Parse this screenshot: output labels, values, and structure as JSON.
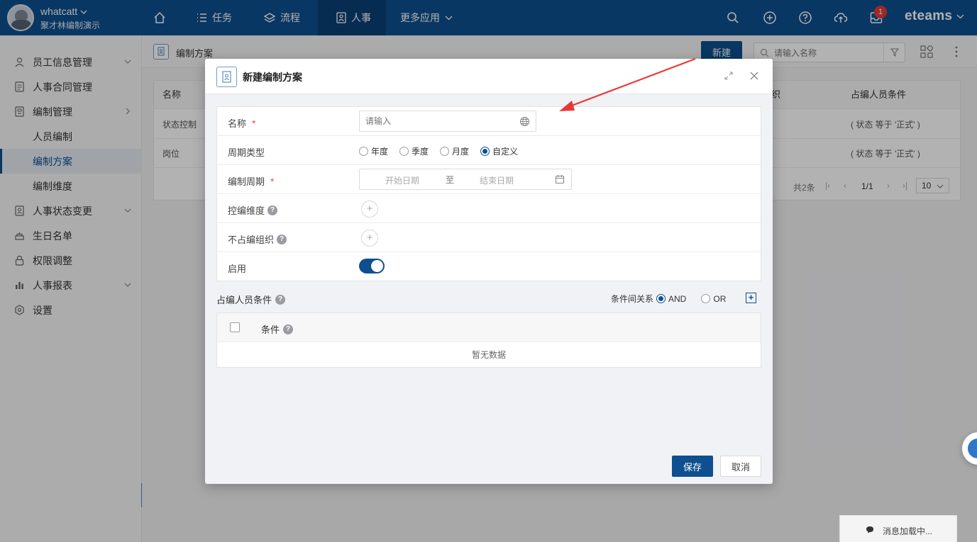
{
  "user": {
    "name": "whatcatt",
    "org": "聚才林编制演示"
  },
  "nav": [
    {
      "label": "",
      "icon": "home-icon"
    },
    {
      "label": "任务",
      "icon": "list-icon"
    },
    {
      "label": "流程",
      "icon": "layers-icon"
    },
    {
      "label": "人事",
      "icon": "person-doc-icon",
      "active": true
    },
    {
      "label": "更多应用",
      "icon": "chevron-down-icon"
    }
  ],
  "topbar": {
    "notification_count": "1",
    "brand": "eteams"
  },
  "sidebar": {
    "items": [
      {
        "label": "员工信息管理",
        "icon": "person-icon",
        "expandable": true
      },
      {
        "label": "人事合同管理",
        "icon": "contract-icon"
      },
      {
        "label": "编制管理",
        "icon": "org-icon",
        "expandable": true
      },
      {
        "label": "人员编制",
        "sub": true
      },
      {
        "label": "编制方案",
        "sub": true,
        "active": true
      },
      {
        "label": "编制维度",
        "sub": true
      },
      {
        "label": "人事状态变更",
        "icon": "status-icon",
        "expandable": true
      },
      {
        "label": "生日名单",
        "icon": "cake-icon"
      },
      {
        "label": "权限调整",
        "icon": "lock-icon"
      },
      {
        "label": "人事报表",
        "icon": "chart-icon",
        "expandable": true
      },
      {
        "label": "设置",
        "icon": "gear-icon"
      }
    ]
  },
  "page": {
    "title": "编制方案",
    "new_label": "新建",
    "search_placeholder": "请输入名称",
    "table": {
      "headers": [
        "名称",
        "织",
        "占编人员条件"
      ],
      "rows": [
        {
          "name": "状态控制",
          "cond": "( 状态 等于 '正式' )"
        },
        {
          "name": "岗位",
          "cond": "( 状态 等于 '正式' )"
        }
      ],
      "total": "共2条",
      "page": "1/1",
      "page_size": "10"
    }
  },
  "modal": {
    "title": "新建编制方案",
    "fields": {
      "name_label": "名称",
      "name_placeholder": "请输入",
      "period_type_label": "周期类型",
      "period_types": [
        "年度",
        "季度",
        "月度",
        "自定义"
      ],
      "period_type_selected": "自定义",
      "period_label": "编制周期",
      "start_placeholder": "开始日期",
      "range_sep": "至",
      "end_placeholder": "结束日期",
      "dimension_label": "控编维度",
      "exclude_org_label": "不占编组织",
      "enable_label": "启用",
      "enabled": true
    },
    "conditions": {
      "title": "占编人员条件",
      "relation_label": "条件间关系",
      "and_label": "AND",
      "or_label": "OR",
      "selected": "AND",
      "column_label": "条件",
      "empty_text": "暂无数据"
    },
    "save_label": "保存",
    "cancel_label": "取消"
  },
  "message": {
    "loading_text": "消息加载中..."
  },
  "colors": {
    "primary": "#0e4f8f",
    "required": "#e5533c",
    "annotation_arrow": "#e53935"
  }
}
